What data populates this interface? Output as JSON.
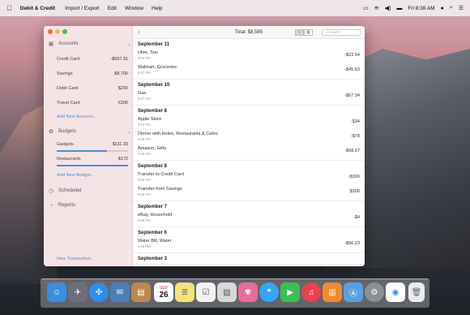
{
  "menubar": {
    "app_name": "Debit & Credit",
    "menus": [
      "Import / Export",
      "Edit",
      "Window",
      "Help"
    ],
    "clock": "Fri 8:36 AM"
  },
  "window": {
    "toolbar": {
      "total": "Total: $8,585",
      "search_placeholder": "Search"
    },
    "sidebar": {
      "accounts_header": "Accounts",
      "accounts": [
        {
          "name": "Credit Card",
          "value": "-$697.31"
        },
        {
          "name": "Savings",
          "value": "$8,700"
        },
        {
          "name": "Debit Card",
          "value": "$200"
        },
        {
          "name": "Travel Card",
          "value": "€300"
        }
      ],
      "add_account": "Add New Account...",
      "budgets_header": "Budgets",
      "budgets": [
        {
          "name": "Gadgets",
          "value": "$111.33",
          "progress": 0.7
        },
        {
          "name": "Restaurants",
          "value": "$172",
          "progress": 1.0
        }
      ],
      "add_budget": "Add New Budget...",
      "scheduled": "Scheduled",
      "reports": "Reports",
      "new_transaction": "New Transaction..."
    },
    "transactions": [
      {
        "date": "September 11",
        "items": [
          {
            "name": "Uber, Taxi",
            "time": "6:04 PM",
            "amount": "-$23.54"
          },
          {
            "name": "Walmart, Groceries",
            "time": "6:57 PM",
            "amount": "-$45.53"
          }
        ]
      },
      {
        "date": "September 10",
        "items": [
          {
            "name": "Gas",
            "time": "6:57 PM",
            "amount": "-$67.34"
          }
        ]
      },
      {
        "date": "September 8",
        "items": [
          {
            "name": "Apple Store",
            "time": "6:03 PM",
            "amount": "-$34"
          },
          {
            "name": "Dinner with Helen, Restaurants & Cafes",
            "time": "9:00 PM",
            "amount": "-$78"
          },
          {
            "name": "Amazon, Gifts",
            "time": "6:58 PM",
            "amount": "-$68.67"
          }
        ]
      },
      {
        "date": "September 8",
        "items": [
          {
            "name": "Transfer to Credit Card",
            "time": "9:00 PM",
            "amount": "-$300"
          },
          {
            "name": "Transfer from Savings",
            "time": "9:00 PM",
            "amount": "$300"
          }
        ]
      },
      {
        "date": "September 7",
        "items": [
          {
            "name": "eBay, Household",
            "time": "6:58 PM",
            "amount": "-$4"
          }
        ]
      },
      {
        "date": "September 6",
        "items": [
          {
            "name": "Water Bill, Water",
            "time": "6:58 PM",
            "amount": "-$56.23"
          }
        ]
      },
      {
        "date": "September 3",
        "items": []
      }
    ]
  },
  "dock": {
    "calendar_month": "SEP",
    "calendar_day": "26"
  }
}
